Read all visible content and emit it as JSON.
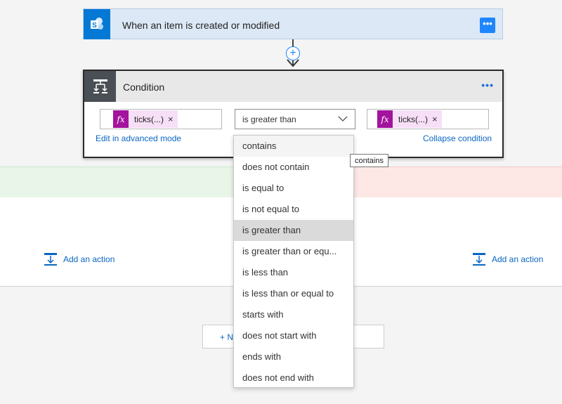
{
  "trigger": {
    "title": "When an item is created or modified",
    "app_icon": "sharepoint-icon",
    "more_label": "•••"
  },
  "connector": {
    "insert_label": "+"
  },
  "condition": {
    "title": "Condition",
    "more_label": "•••",
    "left_token": "ticks(...)",
    "right_token": "ticks(...)",
    "remove_label": "×",
    "fx_label": "fx",
    "operator": "is greater than",
    "edit_advanced_label": "Edit in advanced mode",
    "collapse_label": "Collapse condition"
  },
  "branches": {
    "add_action_label": "Add an action"
  },
  "new_step": {
    "label": "+ N"
  },
  "dropdown": {
    "options": [
      "contains",
      "does not contain",
      "is equal to",
      "is not equal to",
      "is greater than",
      "is greater than or equ...",
      "is less than",
      "is less than or equal to",
      "starts with",
      "does not start with",
      "ends with",
      "does not end with"
    ],
    "hovered_index": 0,
    "selected_index": 4
  },
  "tooltip": {
    "text": "contains"
  },
  "colors": {
    "accent": "#0a66c2",
    "trigger_bg": "#dce8f5",
    "fx": "#a3139e",
    "yes_band": "#e9f5e8",
    "no_band": "#fde8e6"
  }
}
